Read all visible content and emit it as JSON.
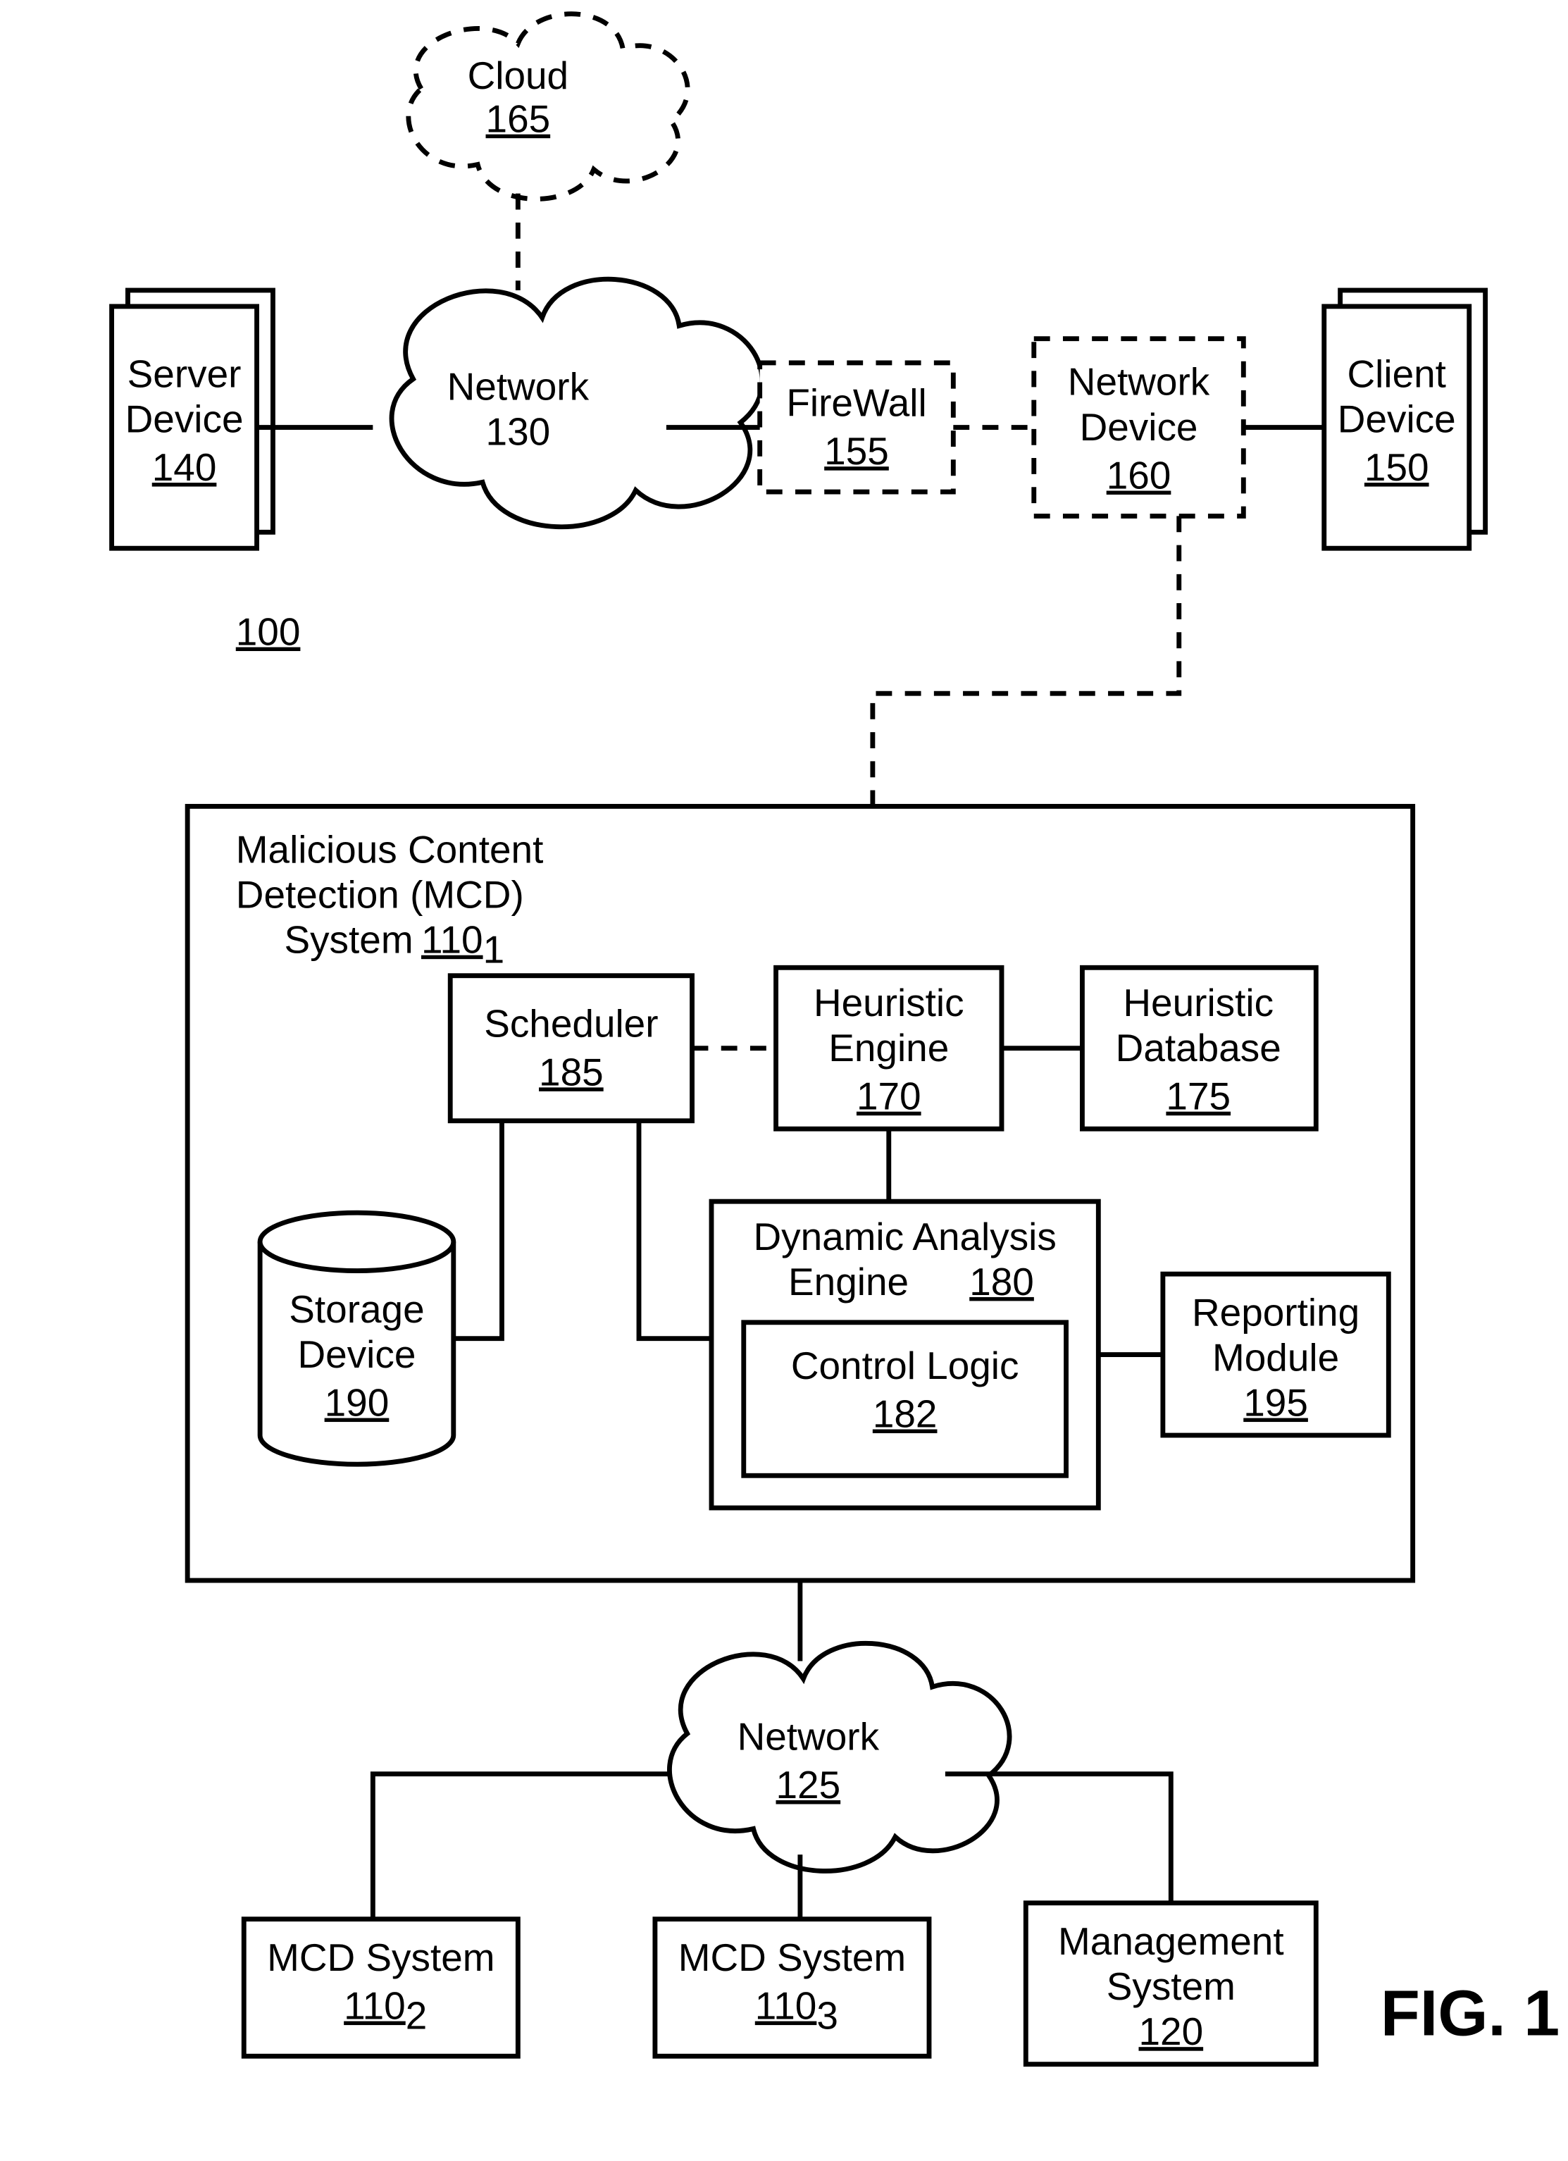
{
  "figure_label": "FIG. 1",
  "nodes": {
    "cloud165": {
      "name": "Cloud",
      "ref": "165"
    },
    "server140": {
      "name1": "Server",
      "name2": "Device",
      "ref": "140"
    },
    "network130": {
      "name": "Network",
      "ref": "130"
    },
    "firewall155": {
      "name": "FireWall",
      "ref": "155"
    },
    "netdev160": {
      "name1": "Network",
      "name2": "Device",
      "ref": "160"
    },
    "client150": {
      "name1": "Client",
      "name2": "Device",
      "ref": "150"
    },
    "sys100": {
      "ref": "100"
    },
    "mcd110_1": {
      "name1": "Malicious Content",
      "name2": "Detection (MCD)",
      "name3": "System",
      "ref": "110",
      "sub": "1"
    },
    "scheduler185": {
      "name": "Scheduler",
      "ref": "185"
    },
    "hengine170": {
      "name1": "Heuristic",
      "name2": "Engine",
      "ref": "170"
    },
    "hdb175": {
      "name1": "Heuristic",
      "name2": "Database",
      "ref": "175"
    },
    "storage190": {
      "name1": "Storage",
      "name2": "Device",
      "ref": "190"
    },
    "dae180": {
      "name1": "Dynamic Analysis",
      "name2": "Engine",
      "ref": "180"
    },
    "ctrl182": {
      "name": "Control Logic",
      "ref": "182"
    },
    "report195": {
      "name1": "Reporting",
      "name2": "Module",
      "ref": "195"
    },
    "network125": {
      "name": "Network",
      "ref": "125"
    },
    "mcd110_2": {
      "name": "MCD System",
      "ref": "110",
      "sub": "2"
    },
    "mcd110_3": {
      "name": "MCD System",
      "ref": "110",
      "sub": "3"
    },
    "mgmt120": {
      "name1": "Management",
      "name2": "System",
      "ref": "120"
    }
  }
}
